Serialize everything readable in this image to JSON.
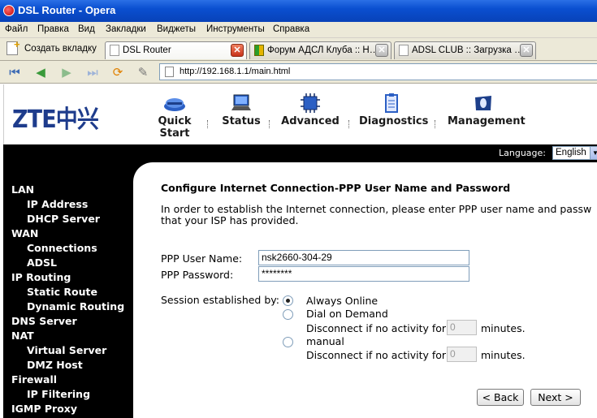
{
  "window": {
    "title": "DSL Router - Opera"
  },
  "menu": [
    "Файл",
    "Правка",
    "Вид",
    "Закладки",
    "Виджеты",
    "Инструменты",
    "Справка"
  ],
  "tabs": {
    "new_tab": "Создать вкладку",
    "items": [
      {
        "label": "DSL Router",
        "active": true
      },
      {
        "label": "Форум АДСЛ Клуба :: Н…",
        "active": false
      },
      {
        "label": "ADSL CLUB :: Загрузка …",
        "active": false
      }
    ]
  },
  "address": {
    "url": "http://192.168.1.1/main.html"
  },
  "router": {
    "logo": "ZTE中兴",
    "nav": [
      {
        "label": "Quick Start",
        "icon": "modem-icon"
      },
      {
        "label": "Status",
        "icon": "laptop-icon"
      },
      {
        "label": "Advanced",
        "icon": "chip-icon"
      },
      {
        "label": "Diagnostics",
        "icon": "clipboard-icon"
      },
      {
        "label": "Management",
        "icon": "management-icon"
      }
    ],
    "language_label": "Language:",
    "language_value": "English"
  },
  "sidebar": {
    "items": [
      "LAN",
      "IP Address",
      "DHCP Server",
      "WAN",
      "Connections",
      "ADSL",
      "IP Routing",
      "Static Route",
      "Dynamic Routing",
      "DNS Server",
      "NAT",
      "Virtual Server",
      "DMZ Host",
      "Firewall",
      "IP Filtering",
      "IGMP Proxy"
    ]
  },
  "form": {
    "heading": "Configure Internet Connection-PPP User Name and Password",
    "intro_line1": "In order to establish the Internet connection, please enter PPP user name and passw",
    "intro_line2": "that your ISP has provided.",
    "username_label": "PPP User Name:",
    "username_value": "nsk2660-304-29",
    "password_label": "PPP Password:",
    "password_value": "********",
    "session_label": "Session established by:",
    "options": {
      "always_online": "Always Online",
      "dial_on_demand": "Dial on Demand",
      "disconnect_text": "Disconnect if no activity for",
      "idle_value_1": "0",
      "minutes": "minutes.",
      "manual": "manual",
      "idle_value_2": "0"
    },
    "back_button": "< Back",
    "next_button": "Next >"
  },
  "colors": {
    "titlebar": "#0a4fd0",
    "nav_bg": "#000000",
    "logo": "#1e3c8c"
  }
}
